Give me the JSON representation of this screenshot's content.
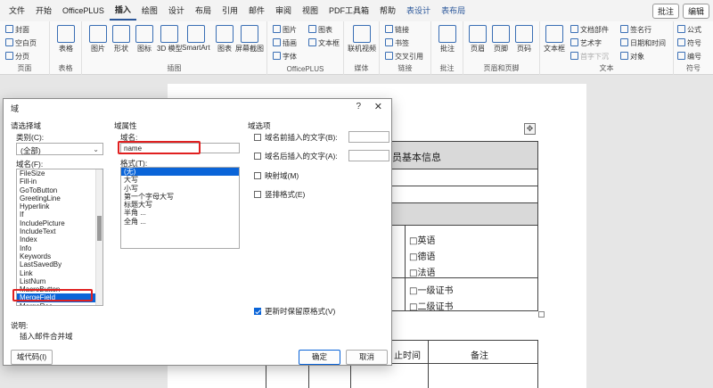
{
  "menubar": {
    "items": [
      "文件",
      "开始",
      "OfficePLUS",
      "插入",
      "绘图",
      "设计",
      "布局",
      "引用",
      "邮件",
      "审阅",
      "视图",
      "PDF工具箱",
      "帮助",
      "表设计",
      "表布局"
    ],
    "active_index": 3,
    "comment_btn": "批注",
    "edit_btn": "编辑"
  },
  "ribbon": {
    "pages": {
      "cover": "封面",
      "blank": "空白页",
      "break": "分页",
      "label": "页面"
    },
    "table": {
      "btn": "表格",
      "label": "表格"
    },
    "illustrations": {
      "picture": "图片",
      "shapes": "形状",
      "icons": "图标",
      "model3d": "3D 模型",
      "smartart": "SmartArt",
      "chart": "图表",
      "screenshot": "屏幕截图",
      "label": "插图"
    },
    "officeplus": {
      "pic": "图片",
      "chart": "图表",
      "draw": "插画",
      "textbox": "文本框",
      "font": "字体",
      "label": "OfficePLUS"
    },
    "media": {
      "video": "联机视频",
      "label": "媒体"
    },
    "links": {
      "link": "链接",
      "bookmark": "书签",
      "crossref": "交叉引用",
      "label": "链接"
    },
    "comments": {
      "btn": "批注",
      "label": "批注"
    },
    "headerfooter": {
      "header": "页眉",
      "footer": "页脚",
      "pagenum": "页码",
      "label": "页眉和页脚"
    },
    "text": {
      "textbox": "文本框",
      "docparts": "文档部件",
      "wordart": "艺术字",
      "dropcap": "首字下沉",
      "signature": "签名行",
      "datetime": "日期和时间",
      "object": "对象",
      "label": "文本"
    },
    "symbols": {
      "equation": "公式",
      "symbol": "符号",
      "number": "编号",
      "label": "符号"
    }
  },
  "document": {
    "title_text": "员基本信息",
    "lang1": "□英语",
    "lang2": "□德语",
    "lang3": "□法语",
    "cert1": "□一级证书",
    "cert2": "□二级证书",
    "time_header": "止时间",
    "note_header": "备注"
  },
  "dialog": {
    "title": "域",
    "help": "?",
    "choose_field": "请选择域",
    "category_label": "类别(C):",
    "category_value": "(全部)",
    "field_names_label": "域名(F):",
    "field_names": [
      "FileSize",
      "Fill-in",
      "GoToButton",
      "GreetingLine",
      "Hyperlink",
      "If",
      "IncludePicture",
      "IncludeText",
      "Index",
      "Info",
      "Keywords",
      "LastSavedBy",
      "Link",
      "ListNum",
      "MacroButton",
      "MergeField",
      "MergeRec"
    ],
    "selected_field": "MergeField",
    "field_props": "域属性",
    "field_name_label": "域名:",
    "field_name_value": "name",
    "format_label": "格式(T):",
    "formats": [
      "(无)",
      "大写",
      "小写",
      "第一个字母大写",
      "标题大写",
      "半角 ...",
      "全角 ..."
    ],
    "field_options": "域选项",
    "opt_before": "域名前插入的文字(B):",
    "opt_after": "域名后插入的文字(A):",
    "opt_mapped": "映射域(M)",
    "opt_vertical": "竖排格式(E)",
    "preserve": "更新时保留原格式(V)",
    "description_label": "说明:",
    "description": "插入邮件合并域",
    "field_codes_btn": "域代码(I)",
    "ok_btn": "确定",
    "cancel_btn": "取消"
  }
}
